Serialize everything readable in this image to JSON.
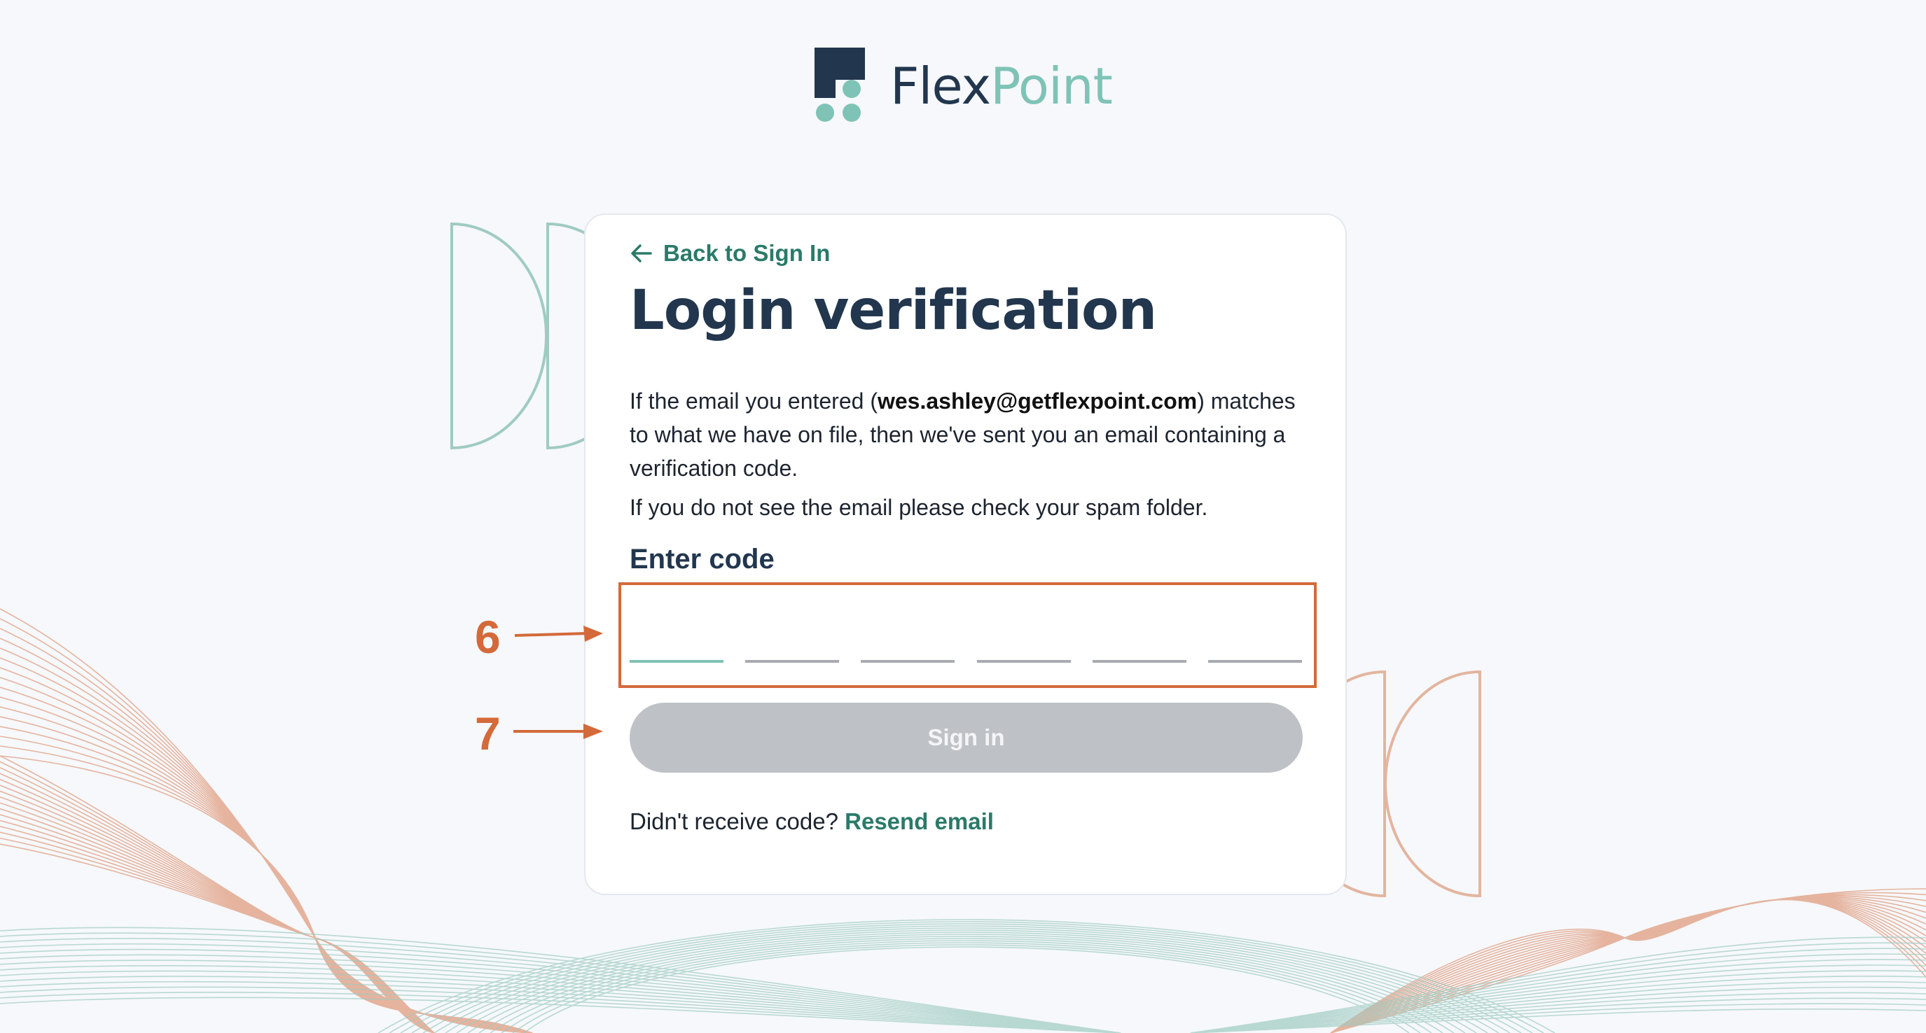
{
  "brand": {
    "name_part1": "Flex",
    "name_part2": "Point",
    "colors": {
      "navy": "#22374e",
      "teal": "#7fc3b6",
      "green_link": "#2b7a69",
      "annotation_orange": "#d4693a",
      "button_disabled": "#bec2c6"
    }
  },
  "card": {
    "back_link": "Back to Sign In",
    "back_icon": "arrow-left-icon",
    "title": "Login verification",
    "desc_before_email": "If the email you entered (",
    "email": "wes.ashley@getflexpoint.com",
    "desc_after_email": ") matches to what we have on file, then we've sent you an email containing a verification code.",
    "spam_note": "If you do not see the email please check your spam folder.",
    "code_label": "Enter code",
    "code_slots": [
      "",
      "",
      "",
      "",
      "",
      ""
    ],
    "signin_label": "Sign in",
    "resend_prompt": "Didn't receive code?",
    "resend_link": "Resend email"
  },
  "annotations": {
    "code_marker": "6",
    "signin_marker": "7"
  }
}
